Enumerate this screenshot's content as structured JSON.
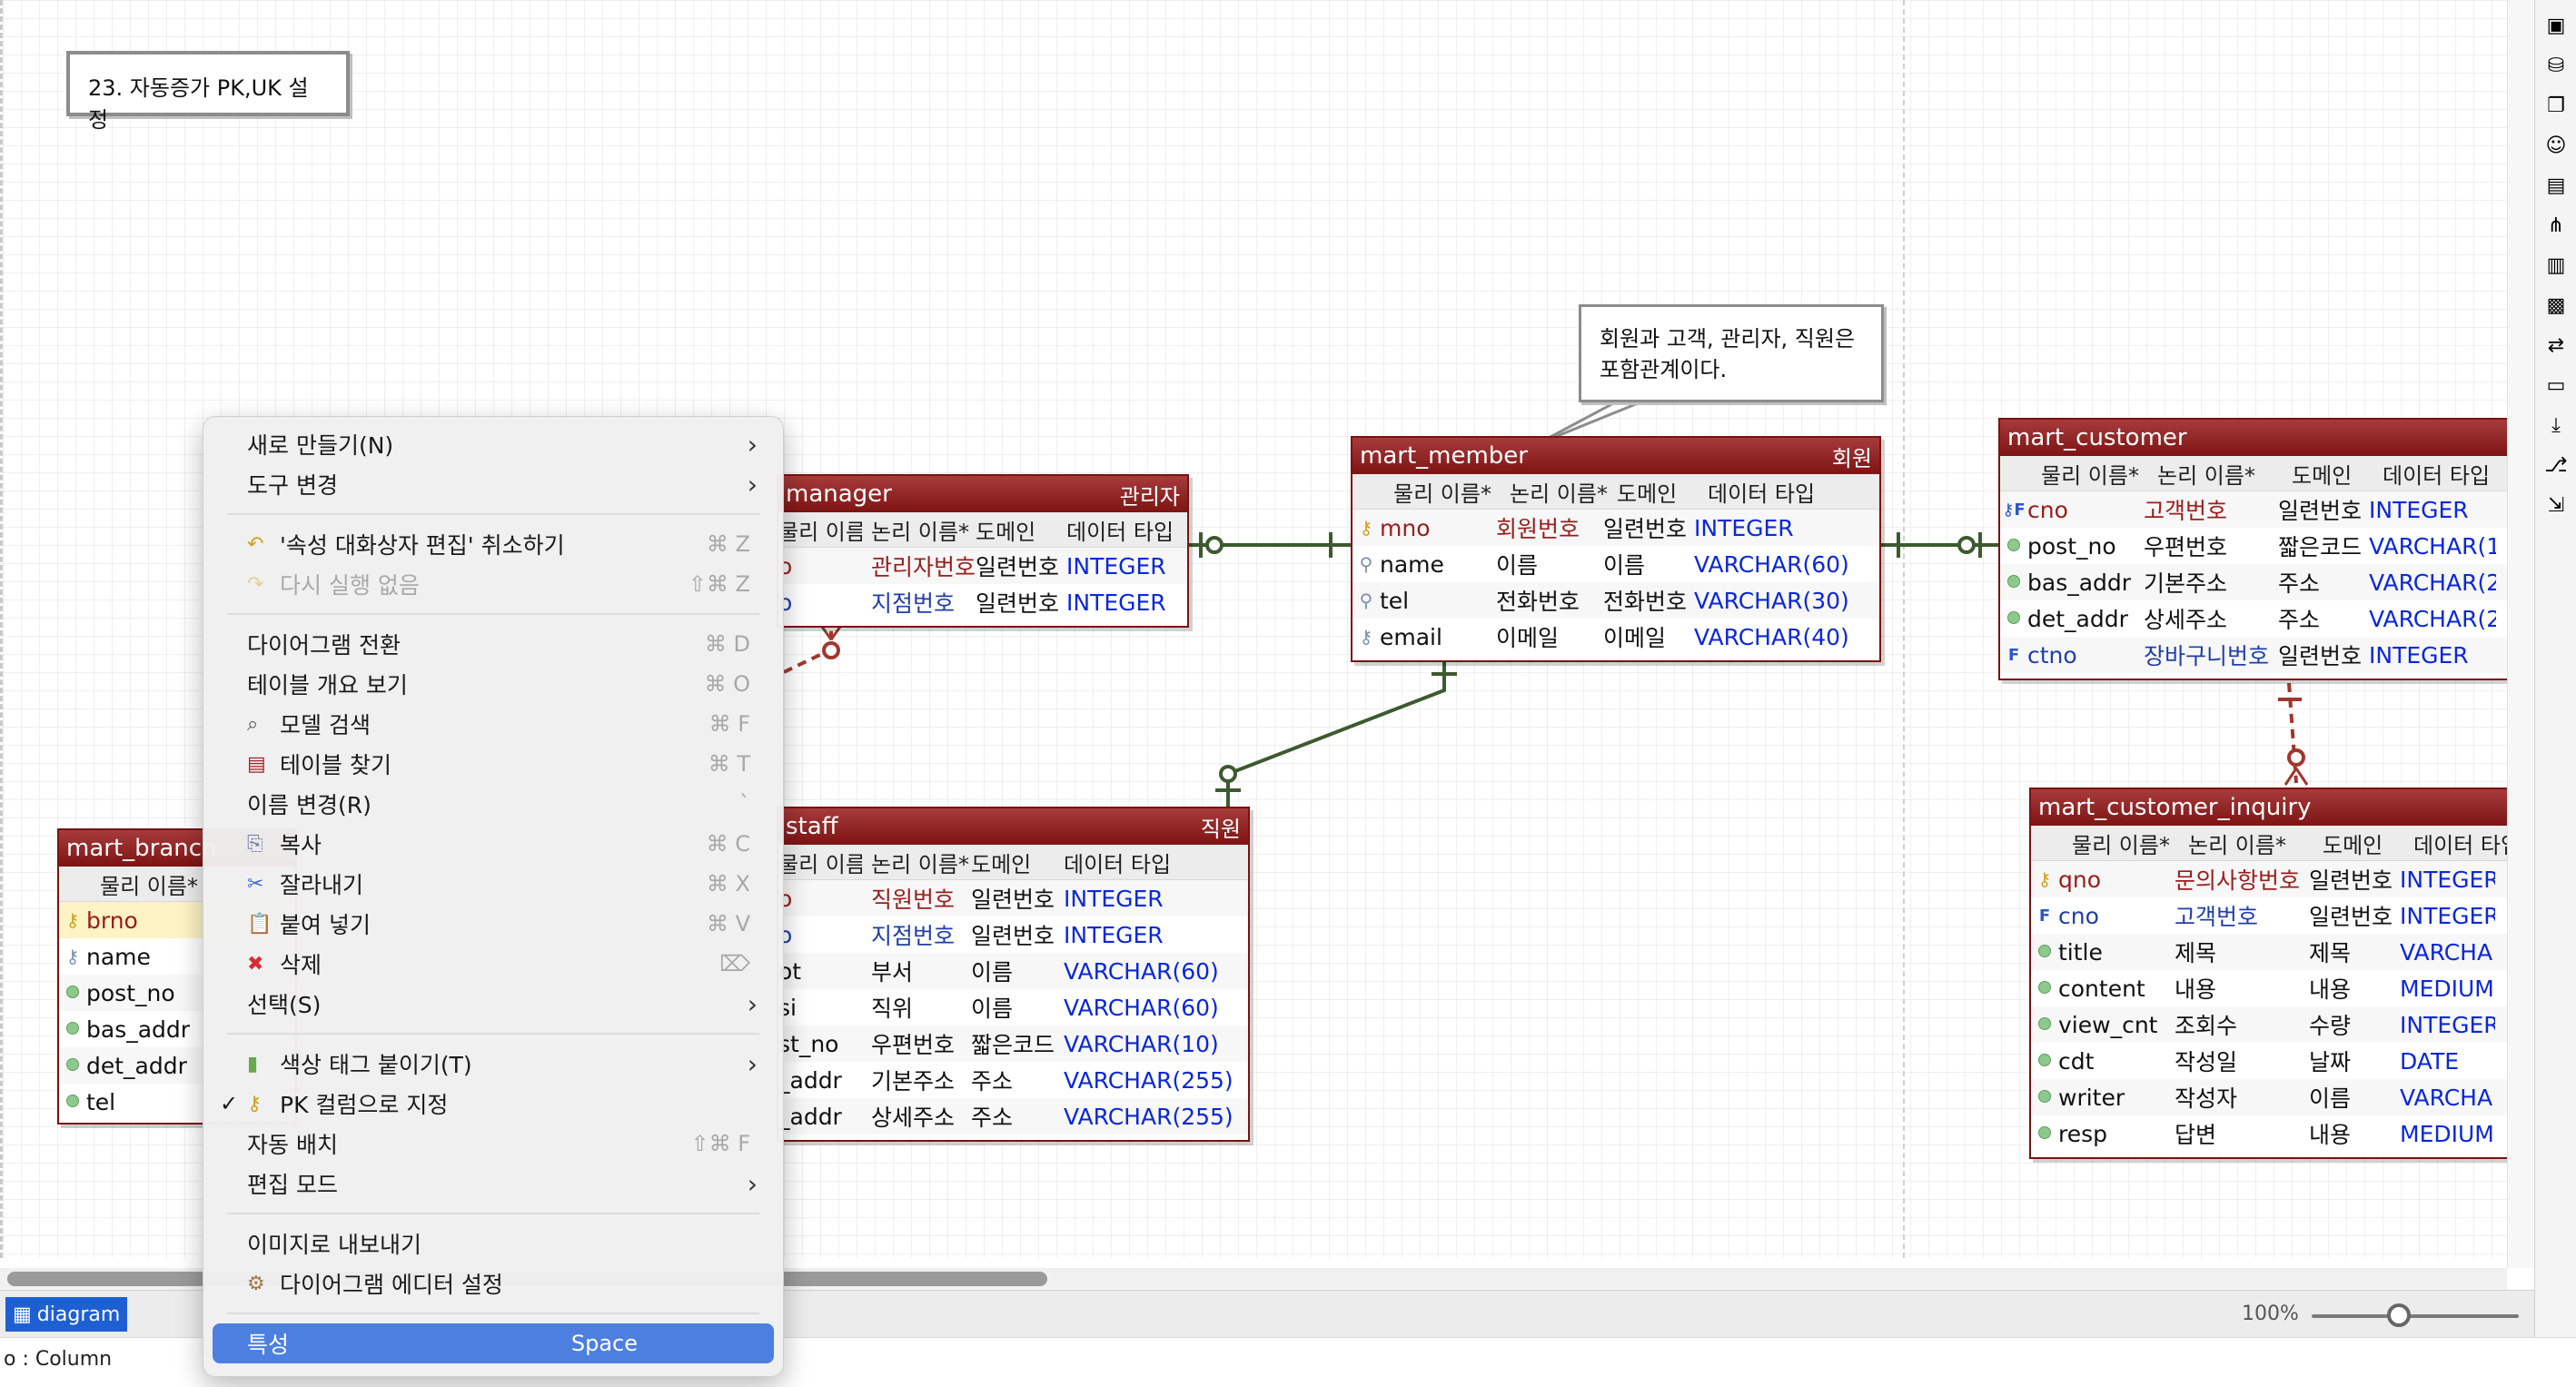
{
  "diagram_title": "23. 자동증가 PK,UK 설정",
  "note": "회원과 고객, 관리자, 직원은 포함관계이다.",
  "colors": {
    "accent": "#4d7fe0",
    "entity_header": "#8b1a1a",
    "type_text": "#0a28d8"
  },
  "col_headers": {
    "physical": "물리 이름*",
    "logical": "논리 이름*",
    "domain": "도메인",
    "datatype": "데이터 타입"
  },
  "entities": {
    "member": {
      "name": "mart_member",
      "logical": "회원",
      "rows": [
        {
          "p": "mno",
          "l": "회원번호",
          "d": "일련번호",
          "t": "INTEGER",
          "k": "pk"
        },
        {
          "p": "name",
          "l": "이름",
          "d": "이름",
          "t": "VARCHAR(60)",
          "k": "idx"
        },
        {
          "p": "tel",
          "l": "전화번호",
          "d": "전화번호",
          "t": "VARCHAR(30)",
          "k": "idx"
        },
        {
          "p": "email",
          "l": "이메일",
          "d": "이메일",
          "t": "VARCHAR(40)",
          "k": "uk"
        }
      ]
    },
    "manager": {
      "name": "manager",
      "logical": "관리자",
      "rows": [
        {
          "p": "o",
          "l": "관리자번호",
          "d": "일련번호",
          "t": "INTEGER",
          "k": "pk"
        },
        {
          "p": "o",
          "l": "지점번호",
          "d": "일련번호",
          "t": "INTEGER",
          "k": "fk"
        }
      ]
    },
    "staff": {
      "name": "staff",
      "logical": "직원",
      "rows": [
        {
          "p": "o",
          "l": "직원번호",
          "d": "일련번호",
          "t": "INTEGER",
          "k": "pk"
        },
        {
          "p": "o",
          "l": "지점번호",
          "d": "일련번호",
          "t": "INTEGER",
          "k": "fk"
        },
        {
          "p": "ot",
          "l": "부서",
          "d": "이름",
          "t": "VARCHAR(60)",
          "k": "col"
        },
        {
          "p": "si",
          "l": "직위",
          "d": "이름",
          "t": "VARCHAR(60)",
          "k": "col"
        },
        {
          "p": "st_no",
          "l": "우편번호",
          "d": "짧은코드",
          "t": "VARCHAR(10)",
          "k": "col"
        },
        {
          "p": "_addr",
          "l": "기본주소",
          "d": "주소",
          "t": "VARCHAR(255)",
          "k": "col"
        },
        {
          "p": "_addr",
          "l": "상세주소",
          "d": "주소",
          "t": "VARCHAR(255)",
          "k": "col"
        }
      ]
    },
    "branch": {
      "name": "mart_branch",
      "physical_hdr": "물리 이름*",
      "rows": [
        {
          "p": "brno",
          "k": "pk"
        },
        {
          "p": "name",
          "k": "uk"
        },
        {
          "p": "post_no",
          "k": "col"
        },
        {
          "p": "bas_addr",
          "k": "col"
        },
        {
          "p": "det_addr",
          "k": "col"
        },
        {
          "p": "tel",
          "k": "col"
        }
      ]
    },
    "customer": {
      "name": "mart_customer",
      "rows": [
        {
          "p": "cno",
          "l": "고객번호",
          "d": "일련번호",
          "t": "INTEGER",
          "k": "pfk"
        },
        {
          "p": "post_no",
          "l": "우편번호",
          "d": "짧은코드",
          "t": "VARCHAR(1",
          "k": "col"
        },
        {
          "p": "bas_addr",
          "l": "기본주소",
          "d": "주소",
          "t": "VARCHAR(2",
          "k": "col"
        },
        {
          "p": "det_addr",
          "l": "상세주소",
          "d": "주소",
          "t": "VARCHAR(2",
          "k": "col"
        },
        {
          "p": "ctno",
          "l": "장바구니번호",
          "d": "일련번호",
          "t": "INTEGER",
          "k": "fk"
        }
      ]
    },
    "inquiry": {
      "name": "mart_customer_inquiry",
      "rows": [
        {
          "p": "qno",
          "l": "문의사항번호",
          "d": "일련번호",
          "t": "INTEGER",
          "k": "pk"
        },
        {
          "p": "cno",
          "l": "고객번호",
          "d": "일련번호",
          "t": "INTEGER",
          "k": "fk"
        },
        {
          "p": "title",
          "l": "제목",
          "d": "제목",
          "t": "VARCHA",
          "k": "col"
        },
        {
          "p": "content",
          "l": "내용",
          "d": "내용",
          "t": "MEDIUM",
          "k": "col"
        },
        {
          "p": "view_cnt",
          "l": "조회수",
          "d": "수량",
          "t": "INTEGER",
          "k": "col"
        },
        {
          "p": "cdt",
          "l": "작성일",
          "d": "날짜",
          "t": "DATE",
          "k": "col"
        },
        {
          "p": "writer",
          "l": "작성자",
          "d": "이름",
          "t": "VARCHA",
          "k": "col"
        },
        {
          "p": "resp",
          "l": "답변",
          "d": "내용",
          "t": "MEDIUM",
          "k": "col"
        }
      ]
    }
  },
  "menu": {
    "new": "새로 만들기(N)",
    "tools": "도구 변경",
    "undo": "'속성 대화상자 편집' 취소하기",
    "undo_sc": "⌘ Z",
    "redo": "다시 실행 없음",
    "redo_sc": "⇧⌘ Z",
    "switch": "다이어그램 전환",
    "switch_sc": "⌘ D",
    "overview": "테이블 개요 보기",
    "overview_sc": "⌘ O",
    "search": "모델 검색",
    "search_sc": "⌘ F",
    "find": "테이블 찾기",
    "find_sc": "⌘ T",
    "rename": "이름 변경(R)",
    "rename_sc": "`",
    "copy": "복사",
    "copy_sc": "⌘ C",
    "cut": "잘라내기",
    "cut_sc": "⌘ X",
    "paste": "붙여 넣기",
    "paste_sc": "⌘ V",
    "delete": "삭제",
    "delete_sc": "⌦",
    "select": "선택(S)",
    "color_tag": "색상 태그 붙이기(T)",
    "pk": "PK 컬럼으로 지정",
    "auto_layout": "자동 배치",
    "auto_layout_sc": "⇧⌘ F",
    "edit_mode": "편집 모드",
    "export": "이미지로 내보내기",
    "settings": "다이어그램 에디터 설정",
    "props": "특성",
    "props_sc": "Space"
  },
  "tab": "diagram",
  "zoom": "100%",
  "zoom_level": 0.42,
  "status": "o : Column"
}
